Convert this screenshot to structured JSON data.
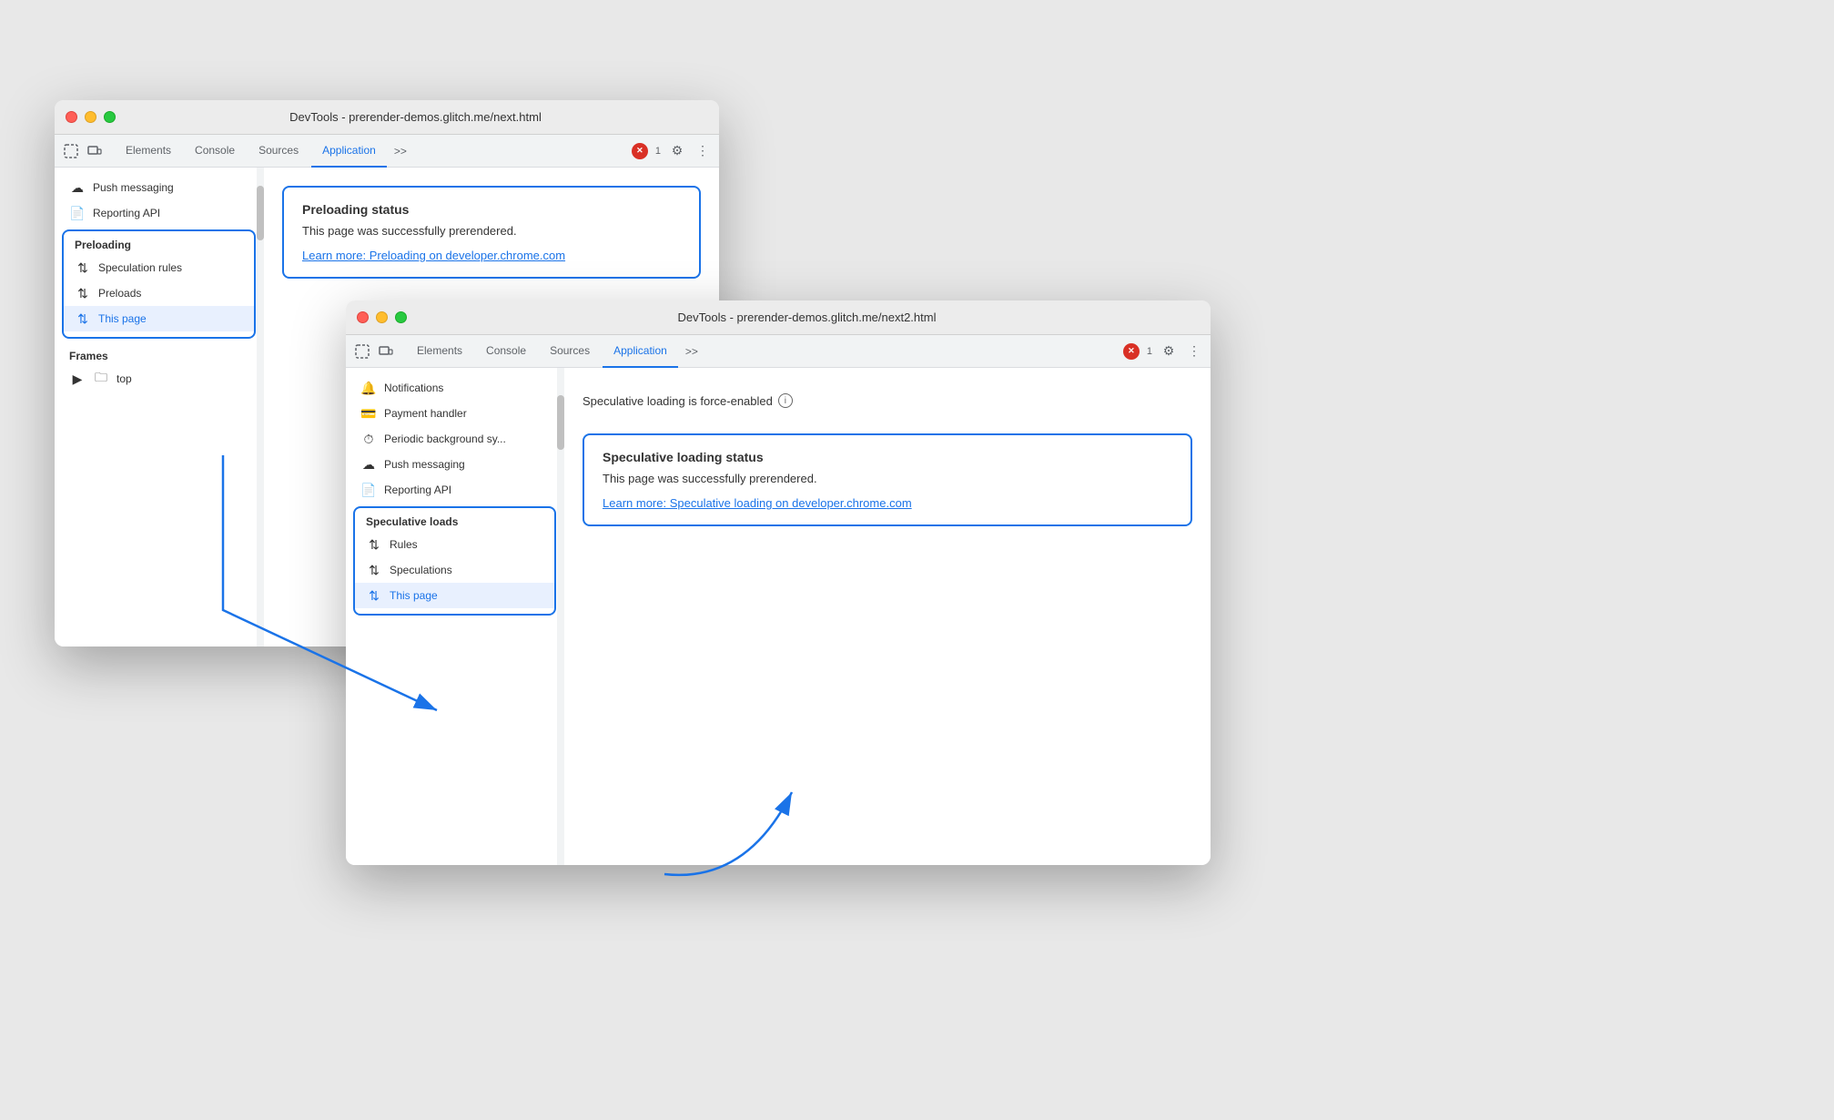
{
  "window1": {
    "title": "DevTools - prerender-demos.glitch.me/next.html",
    "tabs": [
      {
        "label": "Elements",
        "active": false
      },
      {
        "label": "Console",
        "active": false
      },
      {
        "label": "Sources",
        "active": false
      },
      {
        "label": "Application",
        "active": true
      }
    ],
    "error_count": "1",
    "sidebar": {
      "push_messaging": "Push messaging",
      "reporting_api": "Reporting API",
      "preloading_header": "Preloading",
      "speculation_rules": "Speculation rules",
      "preloads": "Preloads",
      "this_page": "This page",
      "frames_header": "Frames",
      "top_label": "top"
    },
    "main": {
      "card_title": "Preloading status",
      "card_text": "This page was successfully prerendered.",
      "card_link": "Learn more: Preloading on developer.chrome.com"
    }
  },
  "window2": {
    "title": "DevTools - prerender-demos.glitch.me/next2.html",
    "tabs": [
      {
        "label": "Elements",
        "active": false
      },
      {
        "label": "Console",
        "active": false
      },
      {
        "label": "Sources",
        "active": false
      },
      {
        "label": "Application",
        "active": true
      }
    ],
    "error_count": "1",
    "sidebar": {
      "notifications": "Notifications",
      "payment_handler": "Payment handler",
      "periodic_bg": "Periodic background sy...",
      "push_messaging": "Push messaging",
      "reporting_api": "Reporting API",
      "speculative_loads_header": "Speculative loads",
      "rules": "Rules",
      "speculations": "Speculations",
      "this_page": "This page"
    },
    "main": {
      "force_enabled": "Speculative loading is force-enabled",
      "card_title": "Speculative loading status",
      "card_text": "This page was successfully prerendered.",
      "card_link": "Learn more: Speculative loading on developer.chrome.com"
    }
  },
  "icons": {
    "cursor": "⬚",
    "responsive": "⬜",
    "more": ">>",
    "settings": "⚙",
    "vertical_dots": "⋮",
    "cloud": "☁",
    "file": "📄",
    "payment": "💳",
    "clock": "⏱",
    "sort": "⇅",
    "folder": "🗀",
    "triangle_right": "▶",
    "info": "i"
  },
  "colors": {
    "accent": "#1a73e8",
    "error": "#d93025",
    "selected_bg": "#e8f0fe"
  }
}
